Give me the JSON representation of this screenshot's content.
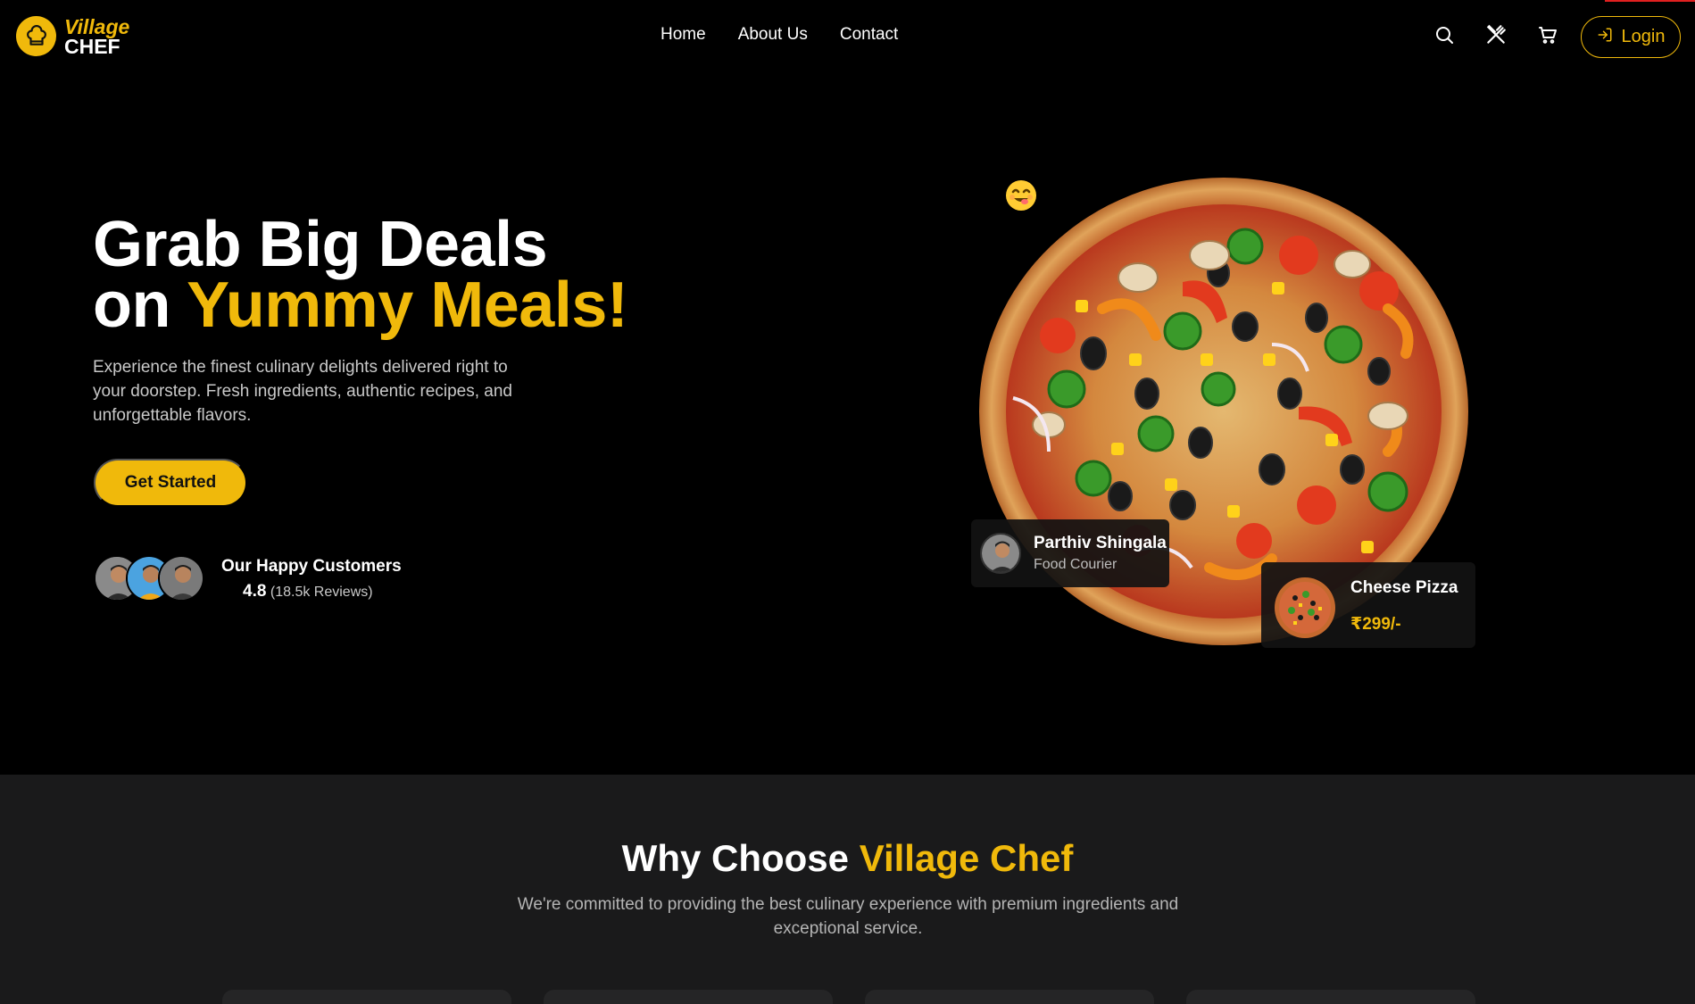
{
  "nav": {
    "logo_line1": "Village",
    "logo_line2": "CHEF",
    "links": [
      "Home",
      "About Us",
      "Contact"
    ],
    "icons": [
      "search-icon",
      "utensils-icon",
      "cart-icon"
    ],
    "login_label": "Login"
  },
  "hero": {
    "title_line1": "Grab Big Deals",
    "title_line2_prefix": "on ",
    "title_line2_accent": "Yummy Meals!",
    "description": "Experience the finest culinary delights delivered right to your doorstep. Fresh ingredients, authentic recipes, and unforgettable flavors.",
    "cta_label": "Get Started",
    "customers_title": "Our Happy Customers",
    "rating": "4.8",
    "reviews": "(18.5k Reviews)"
  },
  "courier_card": {
    "name": "Parthiv Shingala",
    "role": "Food Courier"
  },
  "dish_card": {
    "name": "Cheese Pizza",
    "price": "₹299/-"
  },
  "why": {
    "title_prefix": "Why Choose ",
    "title_accent": "Village Chef",
    "subtitle": "We're committed to providing the best culinary experience with premium ingredients and exceptional service."
  },
  "colors": {
    "accent": "#f0b90b",
    "background": "#000000",
    "section_bg": "#1a1a1b"
  }
}
